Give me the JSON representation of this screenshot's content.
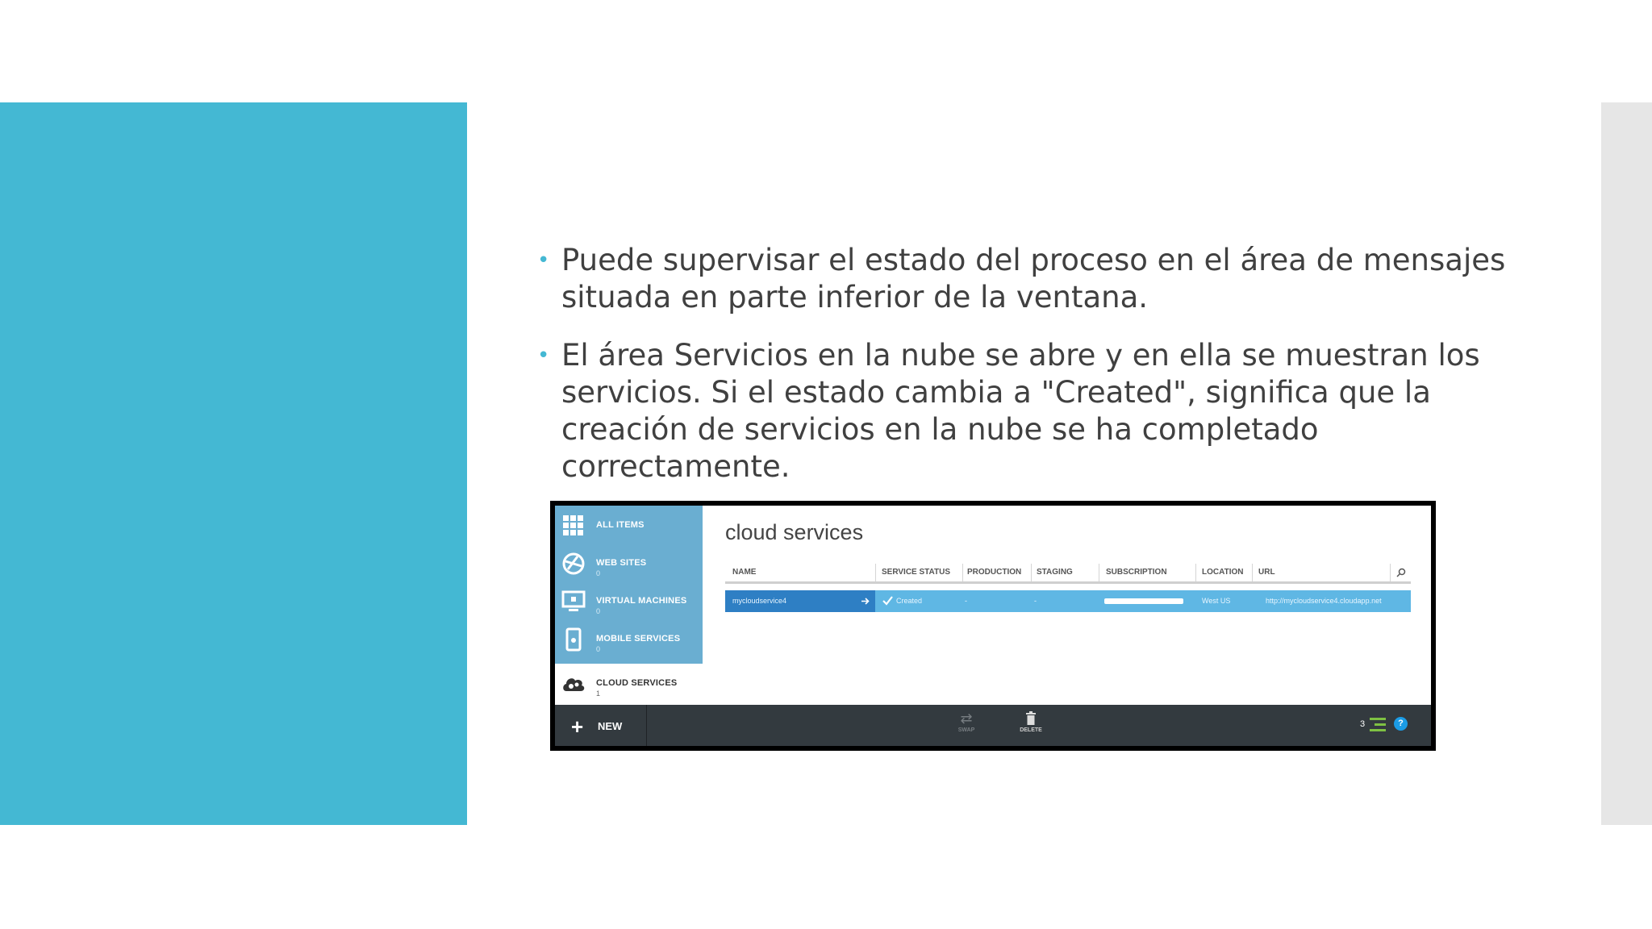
{
  "slide": {
    "bullets": [
      "Puede supervisar el estado del proceso en el área de mensajes situada en parte inferior de la ventana.",
      "El área Servicios en la nube se abre y en ella se muestran los servicios. Si el estado cambia a \"Created\", significa que la creación de servicios en la nube se ha completado correctamente."
    ],
    "colors": {
      "accent": "#44b8d3",
      "side_panel": "#e6e6e6",
      "text": "#404040"
    }
  },
  "portal": {
    "nav": [
      {
        "label": "ALL ITEMS",
        "count": "",
        "icon": "grid-icon"
      },
      {
        "label": "WEB SITES",
        "count": "0",
        "icon": "web-icon"
      },
      {
        "label": "VIRTUAL MACHINES",
        "count": "0",
        "icon": "monitor-icon"
      },
      {
        "label": "MOBILE SERVICES",
        "count": "0",
        "icon": "mobile-icon"
      },
      {
        "label": "CLOUD SERVICES",
        "count": "1",
        "icon": "cloud-gear-icon"
      }
    ],
    "title": "cloud services",
    "columns": [
      "NAME",
      "SERVICE STATUS",
      "PRODUCTION",
      "STAGING",
      "SUBSCRIPTION",
      "LOCATION",
      "URL"
    ],
    "row": {
      "name": "mycloudservice4",
      "status": "Created",
      "production": "-",
      "staging": "-",
      "location": "West US",
      "url": "http://mycloudservice4.cloudapp.net"
    },
    "commands": {
      "new": "NEW",
      "swap": "SWAP",
      "delete": "DELETE",
      "count": "3"
    }
  }
}
